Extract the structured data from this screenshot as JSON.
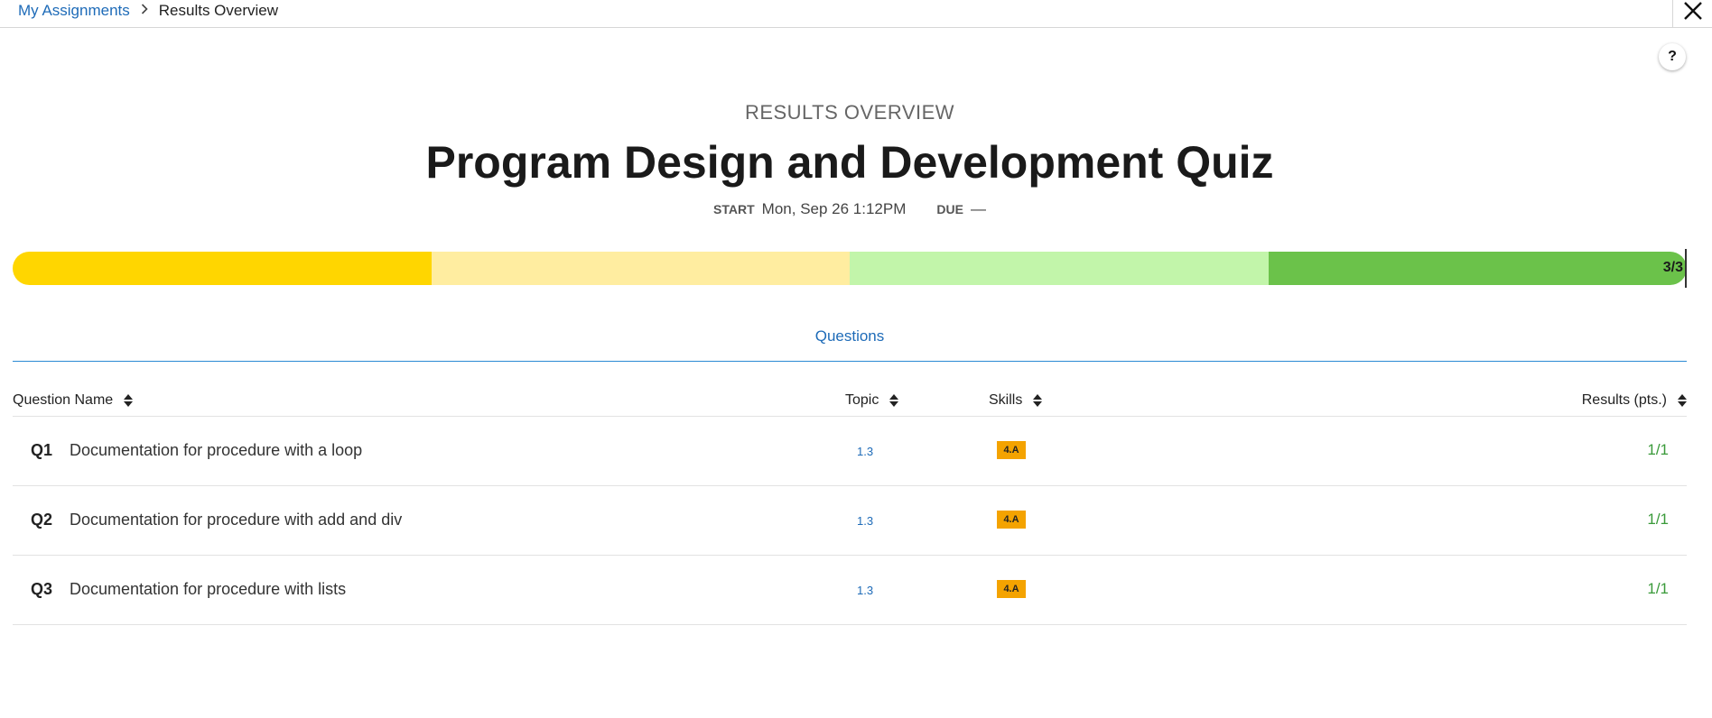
{
  "breadcrumb": {
    "parent": "My Assignments",
    "separator": "›",
    "current": "Results Overview"
  },
  "header": {
    "subtitle": "RESULTS OVERVIEW",
    "title": "Program Design and Development Quiz",
    "start_label": "START",
    "start_value": "Mon, Sep 26 1:12PM",
    "due_label": "DUE",
    "due_value": "—"
  },
  "help_label": "?",
  "progress": {
    "label": "3/3",
    "segments": [
      "#FFD600",
      "#FFEDA0",
      "#C2F5AA",
      "#6BC24A"
    ]
  },
  "tabs": [
    {
      "label": "Questions",
      "active": true
    }
  ],
  "table": {
    "columns": [
      "Question Name",
      "Topic",
      "Skills",
      "Results (pts.)"
    ],
    "rows": [
      {
        "num": "Q1",
        "name": "Documentation for procedure with a loop",
        "topic": "1.3",
        "skill": "4.A",
        "result": "1/1"
      },
      {
        "num": "Q2",
        "name": "Documentation for procedure with add and div",
        "topic": "1.3",
        "skill": "4.A",
        "result": "1/1"
      },
      {
        "num": "Q3",
        "name": "Documentation for procedure with lists",
        "topic": "1.3",
        "skill": "4.A",
        "result": "1/1"
      }
    ]
  },
  "colors": {
    "link": "#1E6BB8",
    "skill_badge": "#F4A300",
    "result": "#3A9A3A"
  },
  "icons": {
    "close": "close-icon",
    "help": "help-icon",
    "sort": "sort-icon",
    "breadcrumb_separator": "chevron-right-icon"
  }
}
